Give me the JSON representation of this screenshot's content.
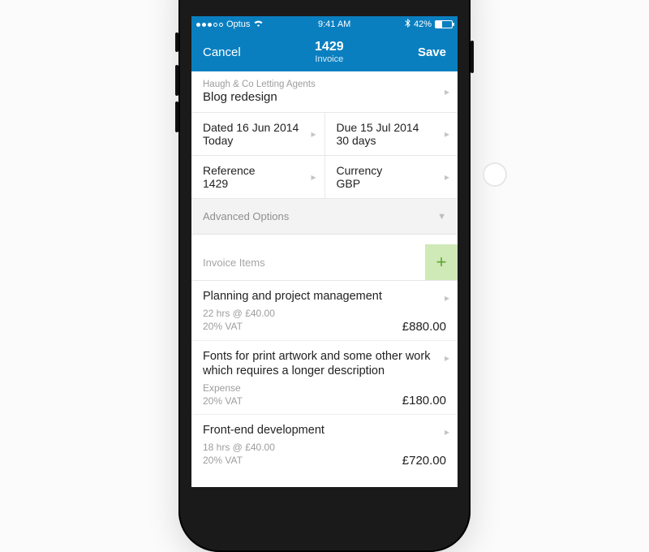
{
  "status": {
    "carrier": "Optus",
    "time": "9:41 AM",
    "battery_pct": "42%"
  },
  "nav": {
    "cancel": "Cancel",
    "save": "Save",
    "title_number": "1429",
    "title_sub": "Invoice"
  },
  "client": {
    "name": "Haugh & Co Letting Agents",
    "project": "Blog redesign"
  },
  "dates": {
    "dated_label": "Dated 16 Jun 2014",
    "dated_value": "Today",
    "due_label": "Due 15 Jul 2014",
    "due_value": "30 days"
  },
  "ref": {
    "label": "Reference",
    "value": "1429"
  },
  "currency": {
    "label": "Currency",
    "value": "GBP"
  },
  "advanced": "Advanced Options",
  "items_header": "Invoice Items",
  "items": [
    {
      "title": "Planning and project management",
      "meta1": "22 hrs @ £40.00",
      "meta2": "20% VAT",
      "price": "£880.00"
    },
    {
      "title": "Fonts for print artwork and some other work which requires a longer description",
      "meta1": "Expense",
      "meta2": "20% VAT",
      "price": "£180.00"
    },
    {
      "title": "Front-end development",
      "meta1": "18 hrs @ £40.00",
      "meta2": "20% VAT",
      "price": "£720.00"
    }
  ]
}
